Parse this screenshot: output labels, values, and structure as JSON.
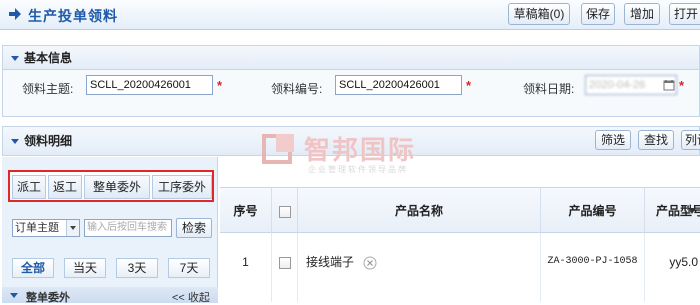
{
  "header": {
    "title": "生产投单领料",
    "buttons": [
      "草稿箱(0)",
      "保存",
      "增加",
      "打开"
    ]
  },
  "basic_info": {
    "section_title": "基本信息",
    "fields": [
      {
        "label": "领料主题:",
        "value": "SCLL_20200426001",
        "required": true
      },
      {
        "label": "领料编号:",
        "value": "SCLL_20200426001",
        "required": true
      },
      {
        "label": "领料日期:",
        "value": "2020-04-26",
        "required": true
      }
    ]
  },
  "detail": {
    "section_title": "领料明细",
    "buttons": [
      "筛选",
      "查找",
      "列设"
    ]
  },
  "watermark": {
    "brand": "智邦国际",
    "tagline": "企业管理软件领导品牌"
  },
  "left_panel": {
    "tabs": [
      "派工",
      "返工",
      "整单委外",
      "工序委外"
    ],
    "filter": {
      "select_value": "订单主题",
      "search_placeholder": "输入后按回车搜索",
      "search_button": "检索"
    },
    "date_buttons": [
      "全部",
      "当天",
      "3天",
      "7天"
    ],
    "active_date": "全部",
    "group": {
      "label": "整单委外",
      "toggle": "<< 收起"
    }
  },
  "table": {
    "columns": [
      "序号",
      "",
      "产品名称",
      "产品编号",
      "产品型号"
    ],
    "rows": [
      {
        "index": "1",
        "product_name": "接线端子",
        "product_code": "ZA-3000-PJ-1058",
        "model": "yy5.0"
      }
    ]
  },
  "colors": {
    "accent": "#1e5aa8",
    "required": "#e02020",
    "highlight_border": "#e02828"
  }
}
